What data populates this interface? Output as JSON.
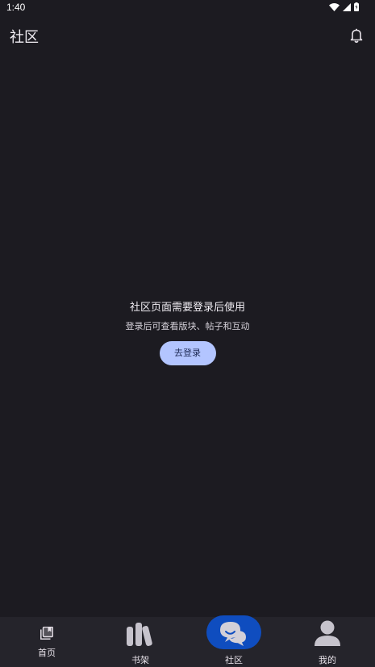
{
  "status_bar": {
    "time": "1:40"
  },
  "app_bar": {
    "title": "社区",
    "notification_icon": "bell-icon"
  },
  "empty_state": {
    "title": "社区页面需要登录后使用",
    "subtitle": "登录后可查看版块、帖子和互动",
    "login_label": "去登录"
  },
  "bottom_nav": {
    "active": "社区",
    "items": [
      {
        "label": "首页",
        "icon": "home-library-icon"
      },
      {
        "label": "书架",
        "icon": "bookshelf-icon"
      },
      {
        "label": "社区",
        "icon": "chat-bubbles-icon"
      },
      {
        "label": "我的",
        "icon": "person-icon"
      }
    ]
  },
  "colors": {
    "background": "#1c1b21",
    "nav_background": "#25242b",
    "accent_button": "#b3c5ff",
    "active_pill": "#0f4dbf"
  }
}
